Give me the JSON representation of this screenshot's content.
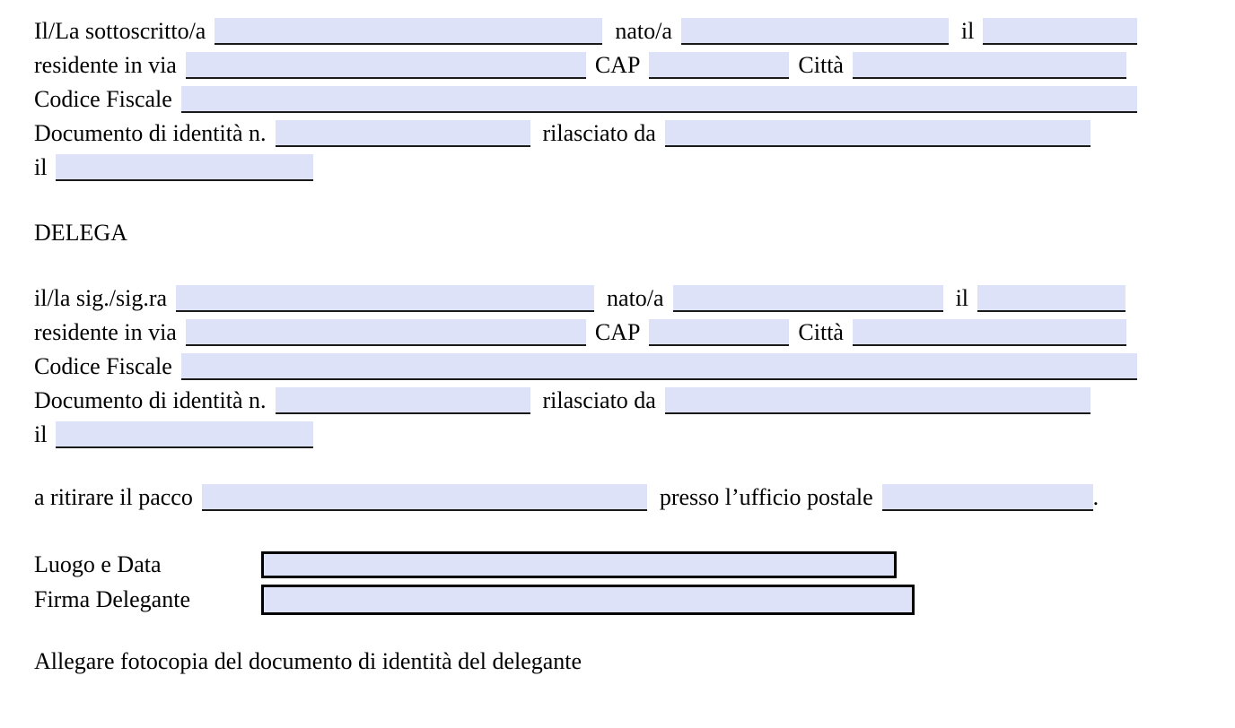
{
  "document": {
    "type": "delega-ritiro-pacco-form",
    "language": "it",
    "background_color": "#ffffff",
    "field_fill_color": "#dde2f8",
    "field_border_color": "#000000",
    "text_color": "#000000"
  },
  "delegante_section": {
    "row1": {
      "label1": "Il/La sottoscritto/a",
      "field1_value": "",
      "label2": "nato/a",
      "field2_value": "",
      "label3": "il",
      "field3_value": ""
    },
    "row2": {
      "label1": "residente in via",
      "field1_value": "",
      "label2": "CAP",
      "field2_value": "",
      "label3": "Città",
      "field3_value": ""
    },
    "row3": {
      "label1": "Codice Fiscale",
      "field1_value": ""
    },
    "row4": {
      "label1": "Documento di identità n.",
      "field1_value": "",
      "label2": "rilasciato da",
      "field2_value": ""
    },
    "row5": {
      "label1": "il",
      "field1_value": ""
    }
  },
  "delega_heading": "DELEGA",
  "delegato_section": {
    "row1": {
      "label1": "il/la sig./sig.ra",
      "field1_value": "",
      "label2": "nato/a",
      "field2_value": "",
      "label3": "il",
      "field3_value": ""
    },
    "row2": {
      "label1": "residente in via",
      "field1_value": "",
      "label2": "CAP",
      "field2_value": "",
      "label3": "Città",
      "field3_value": ""
    },
    "row3": {
      "label1": "Codice Fiscale",
      "field1_value": ""
    },
    "row4": {
      "label1": "Documento di identità n.",
      "field1_value": "",
      "label2": "rilasciato da",
      "field2_value": ""
    },
    "row5": {
      "label1": "il",
      "field1_value": ""
    }
  },
  "purpose_row": {
    "label1": "a ritirare il pacco",
    "field1_value": "",
    "label2": "presso l’ufficio postale",
    "field2_value": "",
    "trailing_punctuation": "."
  },
  "signature_section": {
    "place_date_label": "Luogo e Data",
    "place_date_value": "",
    "signature_label": "Firma Delegante",
    "signature_value": ""
  },
  "footer_note": "Allegare fotocopia del documento di identità del delegante"
}
